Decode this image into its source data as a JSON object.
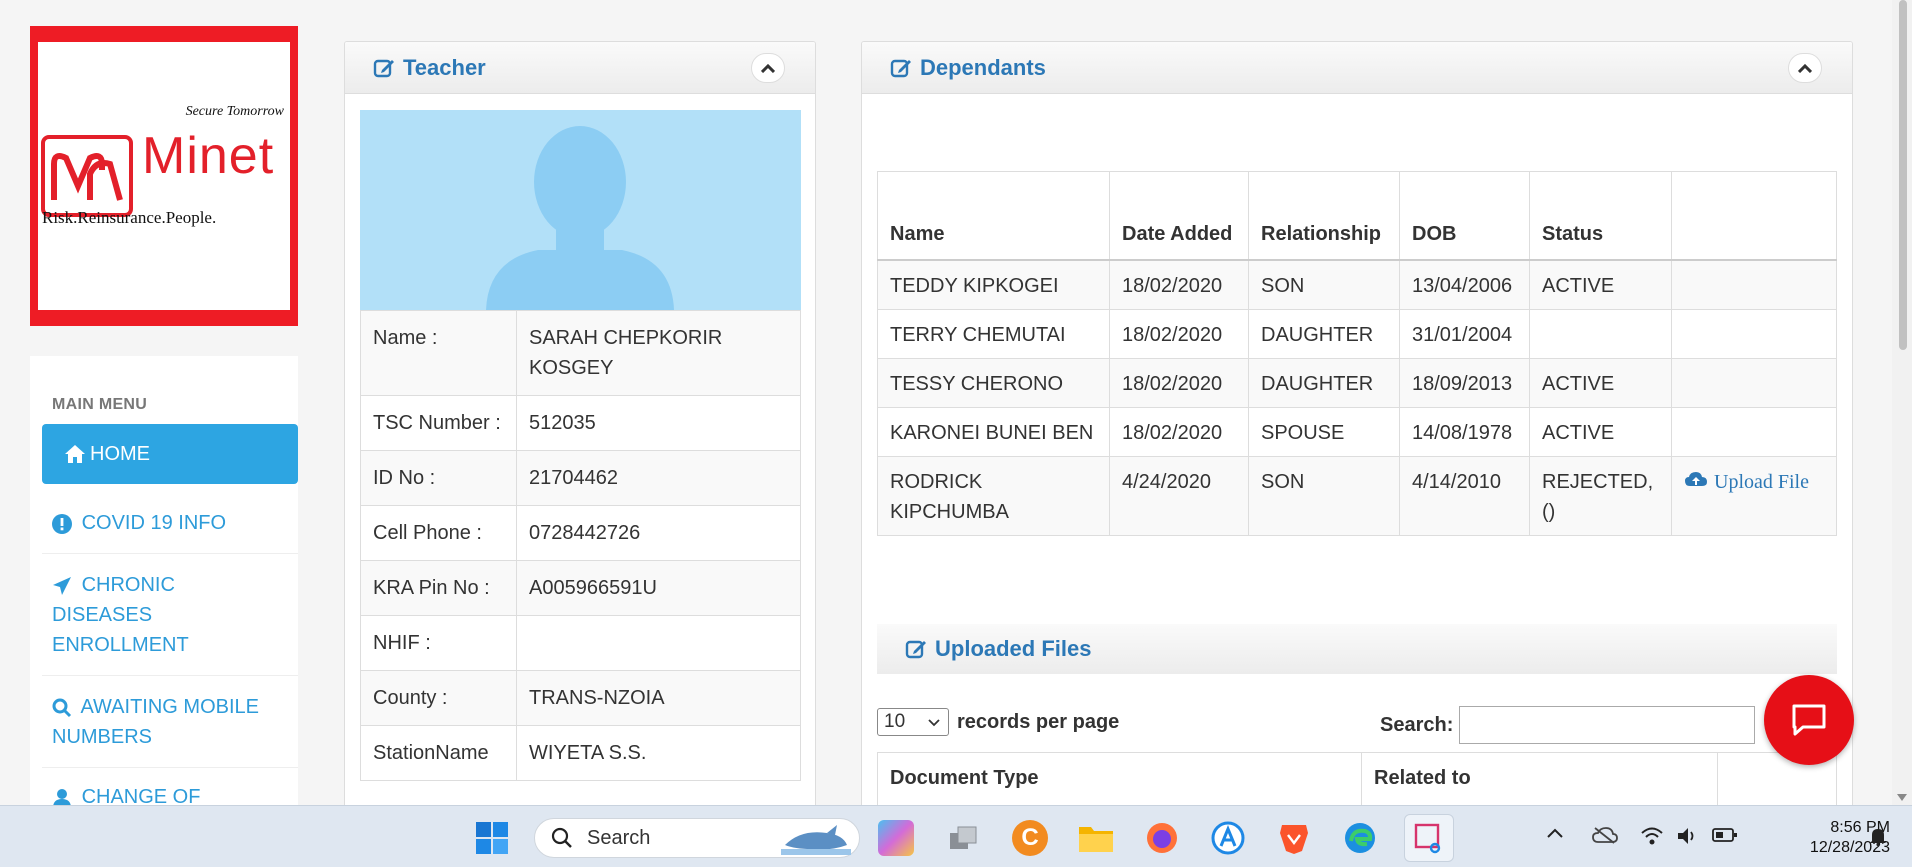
{
  "sidebar": {
    "logo": {
      "tagline": "Secure Tomorrow",
      "brand": "Minet",
      "subtitle": "Risk.Reinsurance.People."
    },
    "menu_heading": "MAIN MENU",
    "items": [
      {
        "label": "HOME",
        "icon": "home-icon",
        "active": true
      },
      {
        "label": "COVID 19 INFO",
        "icon": "exclamation-icon"
      },
      {
        "label": "CHRONIC DISEASES ENROLLMENT",
        "icon": "paper-plane-icon"
      },
      {
        "label": "AWAITING MOBILE NUMBERS",
        "icon": "search-icon"
      },
      {
        "label": "CHANGE OF",
        "icon": "user-icon"
      }
    ]
  },
  "teacher_panel": {
    "title": "Teacher",
    "fields": [
      {
        "label": "Name :",
        "value": "SARAH CHEPKORIR KOSGEY"
      },
      {
        "label": "TSC Number :",
        "value": "512035"
      },
      {
        "label": "ID No :",
        "value": "21704462"
      },
      {
        "label": "Cell Phone :",
        "value": "0728442726"
      },
      {
        "label": "KRA Pin No :",
        "value": "A005966591U"
      },
      {
        "label": "NHIF :",
        "value": ""
      },
      {
        "label": "County :",
        "value": "TRANS-NZOIA"
      },
      {
        "label": "StationName",
        "value": "WIYETA S.S."
      }
    ]
  },
  "dependants_panel": {
    "title": "Dependants",
    "columns": [
      "Name",
      "Date Added",
      "Relationship",
      "DOB",
      "Status",
      ""
    ],
    "rows": [
      {
        "name": "TEDDY KIPKOGEI",
        "date_added": "18/02/2020",
        "relationship": "SON",
        "dob": "13/04/2006",
        "status": "ACTIVE",
        "action": ""
      },
      {
        "name": "TERRY CHEMUTAI",
        "date_added": "18/02/2020",
        "relationship": "DAUGHTER",
        "dob": "31/01/2004",
        "status": "",
        "action": ""
      },
      {
        "name": "TESSY CHERONO",
        "date_added": "18/02/2020",
        "relationship": "DAUGHTER",
        "dob": "18/09/2013",
        "status": "ACTIVE",
        "action": ""
      },
      {
        "name": "KARONEI BUNEI BEN",
        "date_added": "18/02/2020",
        "relationship": "SPOUSE",
        "dob": "14/08/1978",
        "status": "ACTIVE",
        "action": ""
      },
      {
        "name": "RODRICK KIPCHUMBA",
        "date_added": "4/24/2020",
        "relationship": "SON",
        "dob": "4/14/2010",
        "status": "REJECTED, ()",
        "action": "Upload File"
      }
    ],
    "uploaded_files": {
      "title": "Uploaded Files",
      "records_per_page": "10",
      "records_label": "records per page",
      "search_label": "Search:",
      "search_value": "",
      "columns": [
        "Document Type",
        "Related to",
        ""
      ]
    }
  },
  "taskbar": {
    "search_placeholder": "Search",
    "time": "8:56 PM",
    "date": "12/28/2023"
  },
  "colors": {
    "brand_red": "#ee1c25",
    "accent_blue": "#2da5e2",
    "title_blue": "#2c78b6",
    "chat_red": "#e60f17"
  }
}
